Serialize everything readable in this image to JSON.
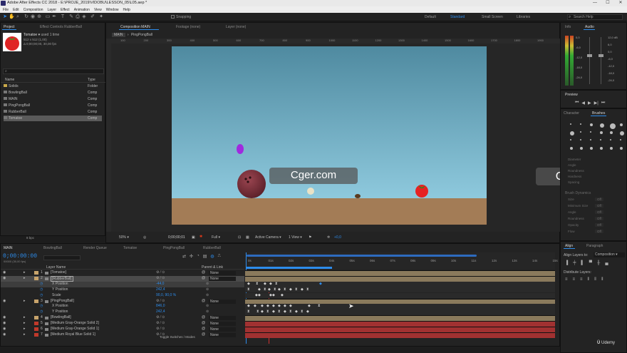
{
  "app": {
    "title": "Adobe After Effects CC 2018 - E:\\PROJE_2019\\VIDOBU\\LESSON_05\\L05.aep *",
    "window_controls": [
      "—",
      "☐",
      "✕"
    ]
  },
  "menu": [
    "File",
    "Edit",
    "Composition",
    "Layer",
    "Effect",
    "Animation",
    "View",
    "Window",
    "Help"
  ],
  "toolbar": {
    "snapping_label": "Snapping",
    "workspaces": [
      {
        "label": "Default",
        "active": false
      },
      {
        "label": "Standard",
        "active": true
      },
      {
        "label": "Small Screen",
        "active": false
      },
      {
        "label": "Libraries",
        "active": false
      }
    ],
    "search_placeholder": "Search Help"
  },
  "project_panel": {
    "tabs": [
      "Project",
      "Effect Controls RubberBall"
    ],
    "selected_item": {
      "name": "Tomatoe",
      "used": "used 1 time",
      "size": "512 x 512 (1,00)",
      "duration": "Δ 0;00;00;00, 30,00 fps"
    },
    "columns": {
      "name": "Name",
      "type": "Type"
    },
    "items": [
      {
        "name": "Solids",
        "type": "Folder",
        "kind": "folder",
        "selected": false
      },
      {
        "name": "BowlingBall",
        "type": "Comp",
        "kind": "comp",
        "selected": false
      },
      {
        "name": "MAIN",
        "type": "Comp",
        "kind": "comp",
        "selected": false
      },
      {
        "name": "PingPongBall",
        "type": "Comp",
        "kind": "comp",
        "selected": false
      },
      {
        "name": "RubberBall",
        "type": "Comp",
        "kind": "comp",
        "selected": false
      },
      {
        "name": "Tomatoe",
        "type": "Comp",
        "kind": "comp",
        "selected": true
      }
    ],
    "bpc": "8 bpc"
  },
  "composition_panel": {
    "tabs": [
      "Composition MAIN",
      "Footage (none)",
      "Layer (none)"
    ],
    "breadcrumbs": [
      "MAIN",
      "PingPongBall"
    ],
    "ruler_ticks": [
      "100",
      "200",
      "300",
      "400",
      "500",
      "600",
      "700",
      "800",
      "900",
      "1000",
      "1100",
      "1200",
      "1300",
      "1400",
      "1500",
      "1600",
      "1700",
      "1800",
      "1900"
    ],
    "bottom_bar": {
      "zoom": "50%",
      "timecode": "0;00;00;01",
      "resolution": "Full",
      "camera": "Active Camera",
      "views": "1 View",
      "exposure": "+0,0"
    }
  },
  "watermark": "Cger.com",
  "timeline": {
    "tabs": [
      "MAIN",
      "BowlingBall",
      "Render Queue",
      "Tomatoe",
      "PingPongBall",
      "RubberBall"
    ],
    "timecode": "0;00:00:00",
    "frame_info": "00000 (30,00 fps)",
    "columns": {
      "layer_name": "Layer Name",
      "parent": "Parent & Link"
    },
    "time_marks": [
      "0s",
      "01s",
      "02s",
      "03s",
      "04s",
      "05s",
      "06s",
      "07s",
      "08s",
      "09s",
      "10s",
      "11s",
      "12s",
      "13s",
      "14s",
      "15s"
    ],
    "layers": [
      {
        "num": "1",
        "name": "[Tomatoe]",
        "color": "#c7a36b",
        "parent": "None",
        "kind": "layer"
      },
      {
        "num": "2",
        "name": "[RubberBall]",
        "color": "#c7a36b",
        "parent": "None",
        "kind": "layer",
        "selected": true
      },
      {
        "num": "",
        "name": "X Position",
        "value": "-44,0",
        "kind": "prop",
        "selected": true
      },
      {
        "num": "",
        "name": "Y Position",
        "value": "242,4",
        "kind": "prop"
      },
      {
        "num": "",
        "name": "Scale",
        "value": "90,0, 90,0 %",
        "kind": "prop"
      },
      {
        "num": "3",
        "name": "[PingPongBall]",
        "color": "#c7a36b",
        "parent": "None",
        "kind": "layer"
      },
      {
        "num": "",
        "name": "X Position",
        "value": "846,0",
        "kind": "prop"
      },
      {
        "num": "",
        "name": "Y Position",
        "value": "242,4",
        "kind": "prop"
      },
      {
        "num": "4",
        "name": "[BowlingBall]",
        "color": "#c7a36b",
        "parent": "None",
        "kind": "layer"
      },
      {
        "num": "5",
        "name": "[Medium Gray-Orange Solid 2]",
        "color": "#c0392b",
        "parent": "None",
        "kind": "layer"
      },
      {
        "num": "6",
        "name": "[Medium Gray-Orange Solid 1]",
        "color": "#c0392b",
        "parent": "None",
        "kind": "layer"
      },
      {
        "num": "7",
        "name": "[Medium Royal Blue Solid 1]",
        "color": "#c0392b",
        "parent": "None",
        "kind": "layer"
      }
    ],
    "toggle_label": "Toggle Switches / Modes"
  },
  "right_panels": {
    "top_tabs": [
      "Info",
      "Audio"
    ],
    "audio_db_left": [
      "0,0",
      "-6,0",
      "-12,0",
      "-18,0",
      "-24,0"
    ],
    "audio_db_right": [
      "12,0 dB",
      "6,0",
      "0,0",
      "-6,0",
      "-12,0",
      "-18,0",
      "-24,0"
    ],
    "preview_title": "Preview",
    "char_tabs": [
      "Character",
      "Brushes"
    ],
    "brush_fields": [
      "Diameter",
      "Angle",
      "Roundness",
      "Hardness",
      "Spacing"
    ],
    "brush_dynamics": "Brush Dynamics",
    "dyn_fields": [
      "Size",
      "Minimum Size",
      "Angle",
      "Roundness",
      "Opacity",
      "Flow"
    ],
    "dyn_value": "Off",
    "align_tabs": [
      "Align",
      "Paragraph"
    ],
    "align_layers_to": "Align Layers to:",
    "align_target": "Composition",
    "distribute_layers": "Distribute Layers:"
  },
  "udemy": "Udemy"
}
